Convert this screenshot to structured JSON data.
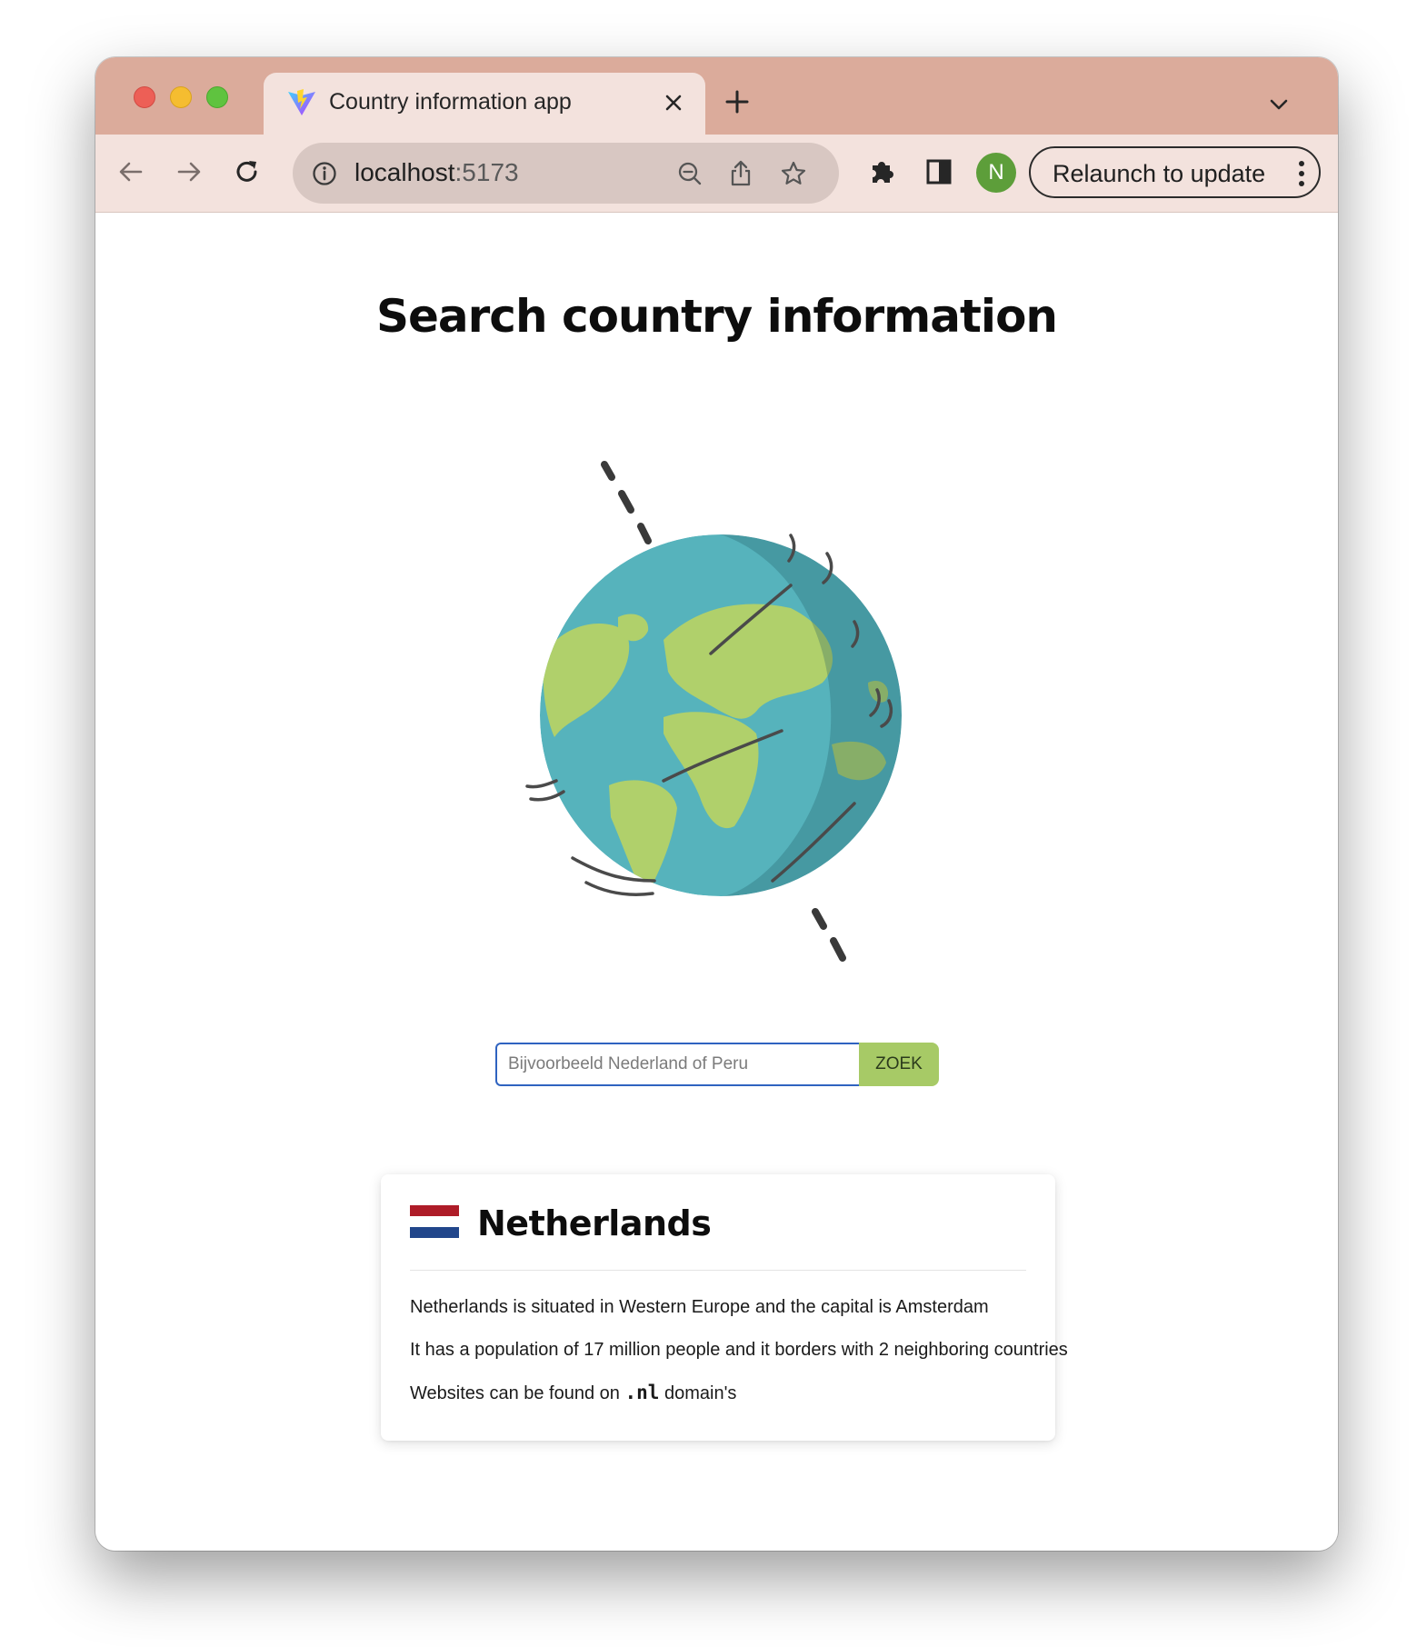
{
  "browser": {
    "tab_title": "Country information app",
    "url_host": "localhost",
    "url_port": ":5173",
    "profile_initial": "N",
    "relaunch_label": "Relaunch to update",
    "profile_color": "#5d9e3a",
    "tabstrip_color": "#dbab9b",
    "toolbar_color": "#f3e2dd"
  },
  "page": {
    "title": "Search country information",
    "search": {
      "placeholder": "Bijvoorbeeld Nederland of Peru",
      "value": "",
      "button_label": "ZOEK",
      "button_color": "#a7ca66"
    },
    "result": {
      "country": "Netherlands",
      "flag_colors": [
        "#ae1c28",
        "#ffffff",
        "#21468b"
      ],
      "line1": "Netherlands is situated in Western Europe and the capital is Amsterdam",
      "line2": "It has a population of 17 million people and it borders with 2 neighboring countries",
      "line3_prefix": "Websites can be found on",
      "line3_domain": ".nl",
      "line3_suffix": "domain's"
    }
  },
  "icons": [
    "vite-favicon",
    "close-icon",
    "plus-icon",
    "chevron-down-icon",
    "back-arrow-icon",
    "forward-arrow-icon",
    "reload-icon",
    "info-icon",
    "zoom-out-icon",
    "share-icon",
    "star-icon",
    "puzzle-icon",
    "side-panel-icon",
    "kebab-menu-icon",
    "globe-illustration"
  ]
}
